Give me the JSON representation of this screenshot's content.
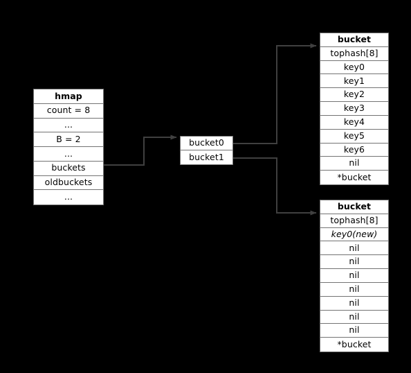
{
  "diagram": {
    "title": "Go hmap bucket growth diagram",
    "background_color": "#000000",
    "box_fill": "#ffffff",
    "box_border": "#737373",
    "edge_color": "#404040",
    "text_color": "#000000"
  },
  "hmap": {
    "header": "hmap",
    "fields": [
      "count = 8",
      "...",
      "B = 2",
      "...",
      "buckets",
      "oldbuckets",
      "..."
    ]
  },
  "bucket_array": {
    "entries": [
      "bucket0",
      "bucket1"
    ]
  },
  "buckets": [
    {
      "header": "bucket",
      "rows": [
        {
          "text": "tophash[8]",
          "italic": false
        },
        {
          "text": "key0",
          "italic": false
        },
        {
          "text": "key1",
          "italic": false
        },
        {
          "text": "key2",
          "italic": false
        },
        {
          "text": "key3",
          "italic": false
        },
        {
          "text": "key4",
          "italic": false
        },
        {
          "text": "key5",
          "italic": false
        },
        {
          "text": "key6",
          "italic": false
        },
        {
          "text": "nil",
          "italic": false
        },
        {
          "text": "*bucket",
          "italic": false
        }
      ]
    },
    {
      "header": "bucket",
      "rows": [
        {
          "text": "tophash[8]",
          "italic": false
        },
        {
          "text": "key0(new)",
          "italic": true
        },
        {
          "text": "nil",
          "italic": false
        },
        {
          "text": "nil",
          "italic": false
        },
        {
          "text": "nil",
          "italic": false
        },
        {
          "text": "nil",
          "italic": false
        },
        {
          "text": "nil",
          "italic": false
        },
        {
          "text": "nil",
          "italic": false
        },
        {
          "text": "nil",
          "italic": false
        },
        {
          "text": "*bucket",
          "italic": false
        }
      ]
    }
  ],
  "edges": [
    {
      "from": "hmap.buckets",
      "to": "bucket_array.bucket0"
    },
    {
      "from": "bucket_array.bucket0",
      "to": "buckets.0"
    },
    {
      "from": "bucket_array.bucket1",
      "to": "buckets.1"
    }
  ]
}
